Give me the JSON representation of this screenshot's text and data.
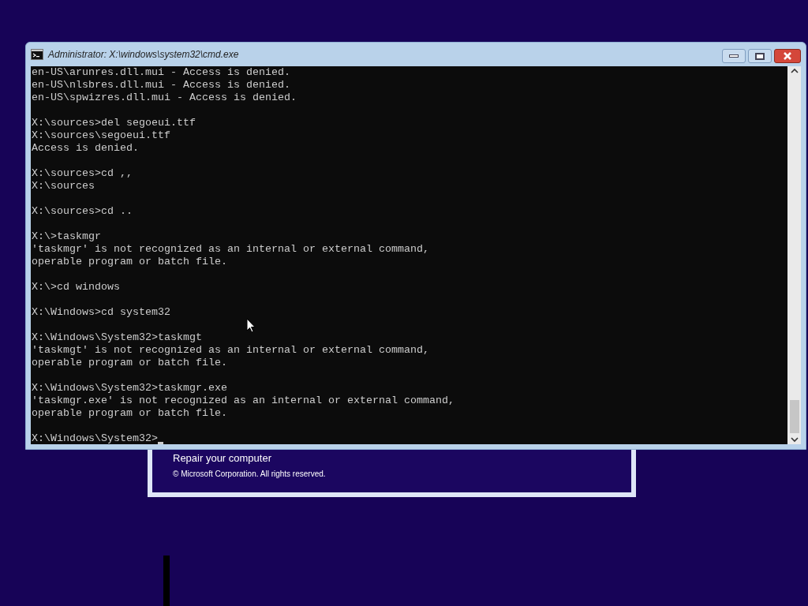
{
  "background_dialog": {
    "repair_link": "Repair your computer",
    "copyright": "© Microsoft Corporation. All rights reserved."
  },
  "window": {
    "title": "Administrator: X:\\windows\\system32\\cmd.exe"
  },
  "console": {
    "blocks": [
      [
        "en-US\\arunres.dll.mui - Access is denied.",
        "en-US\\nlsbres.dll.mui - Access is denied.",
        "en-US\\spwizres.dll.mui - Access is denied."
      ],
      [
        "X:\\sources>del segoeui.ttf",
        "X:\\sources\\segoeui.ttf",
        "Access is denied."
      ],
      [
        "X:\\sources>cd ,,",
        "X:\\sources"
      ],
      [
        "X:\\sources>cd .."
      ],
      [
        "X:\\>taskmgr",
        "'taskmgr' is not recognized as an internal or external command,",
        "operable program or batch file."
      ],
      [
        "X:\\>cd windows"
      ],
      [
        "X:\\Windows>cd system32"
      ],
      [
        "X:\\Windows\\System32>taskmgt",
        "'taskmgt' is not recognized as an internal or external command,",
        "operable program or batch file."
      ],
      [
        "X:\\Windows\\System32>taskmgr.exe",
        "'taskmgr.exe' is not recognized as an internal or external command,",
        "operable program or batch file."
      ]
    ],
    "prompt": "X:\\Windows\\System32>"
  }
}
